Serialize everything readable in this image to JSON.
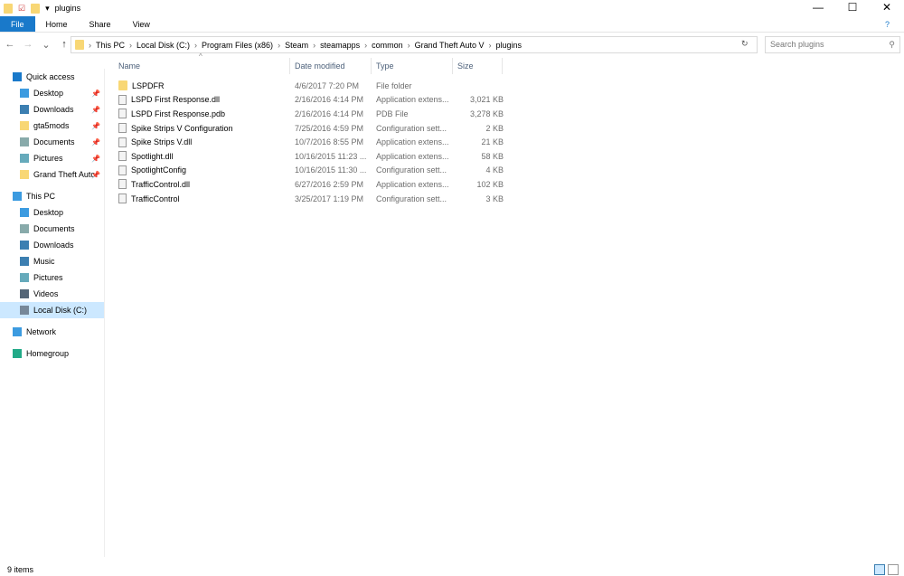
{
  "window": {
    "title": "plugins",
    "controls": [
      "—",
      "☐",
      "✕"
    ]
  },
  "ribbon": {
    "tabs": [
      "File",
      "Home",
      "Share",
      "View"
    ]
  },
  "address": {
    "crumbs": [
      "This PC",
      "Local Disk (C:)",
      "Program Files (x86)",
      "Steam",
      "steamapps",
      "common",
      "Grand Theft Auto V",
      "plugins"
    ],
    "search_placeholder": "Search plugins"
  },
  "sidebar": {
    "items": [
      {
        "label": "Quick access",
        "level": 0,
        "icon": "star-icon"
      },
      {
        "label": "Desktop",
        "level": 1,
        "icon": "desktop-icon",
        "pinned": true
      },
      {
        "label": "Downloads",
        "level": 1,
        "icon": "download-icon",
        "pinned": true
      },
      {
        "label": "gta5mods",
        "level": 1,
        "icon": "folder-icon",
        "pinned": true
      },
      {
        "label": "Documents",
        "level": 1,
        "icon": "documents-icon",
        "pinned": true
      },
      {
        "label": "Pictures",
        "level": 1,
        "icon": "pictures-icon",
        "pinned": true
      },
      {
        "label": "Grand Theft Auto V",
        "level": 1,
        "icon": "folder-icon",
        "pinned": true
      },
      {
        "label": "",
        "level": -1
      },
      {
        "label": "This PC",
        "level": 0,
        "icon": "computer-icon"
      },
      {
        "label": "Desktop",
        "level": 1,
        "icon": "desktop-icon"
      },
      {
        "label": "Documents",
        "level": 1,
        "icon": "documents-icon"
      },
      {
        "label": "Downloads",
        "level": 1,
        "icon": "download-icon"
      },
      {
        "label": "Music",
        "level": 1,
        "icon": "music-icon"
      },
      {
        "label": "Pictures",
        "level": 1,
        "icon": "pictures-icon"
      },
      {
        "label": "Videos",
        "level": 1,
        "icon": "videos-icon"
      },
      {
        "label": "Local Disk (C:)",
        "level": 1,
        "icon": "drive-icon",
        "selected": true
      },
      {
        "label": "",
        "level": -1
      },
      {
        "label": "Network",
        "level": 0,
        "icon": "network-icon"
      },
      {
        "label": "",
        "level": -1
      },
      {
        "label": "Homegroup",
        "level": 0,
        "icon": "homegroup-icon"
      }
    ]
  },
  "columns": [
    "Name",
    "Date modified",
    "Type",
    "Size"
  ],
  "files": [
    {
      "name": "LSPDFR",
      "date": "4/6/2017 7:20 PM",
      "type": "File folder",
      "size": "",
      "folder": true
    },
    {
      "name": "LSPD First Response.dll",
      "date": "2/16/2016 4:14 PM",
      "type": "Application extens...",
      "size": "3,021 KB"
    },
    {
      "name": "LSPD First Response.pdb",
      "date": "2/16/2016 4:14 PM",
      "type": "PDB File",
      "size": "3,278 KB"
    },
    {
      "name": "Spike Strips V Configuration",
      "date": "7/25/2016 4:59 PM",
      "type": "Configuration sett...",
      "size": "2 KB"
    },
    {
      "name": "Spike Strips V.dll",
      "date": "10/7/2016 8:55 PM",
      "type": "Application extens...",
      "size": "21 KB"
    },
    {
      "name": "Spotlight.dll",
      "date": "10/16/2015 11:23 ...",
      "type": "Application extens...",
      "size": "58 KB"
    },
    {
      "name": "SpotlightConfig",
      "date": "10/16/2015 11:30 ...",
      "type": "Configuration sett...",
      "size": "4 KB"
    },
    {
      "name": "TrafficControl.dll",
      "date": "6/27/2016 2:59 PM",
      "type": "Application extens...",
      "size": "102 KB"
    },
    {
      "name": "TrafficControl",
      "date": "3/25/2017 1:19 PM",
      "type": "Configuration sett...",
      "size": "3 KB"
    }
  ],
  "status": {
    "count": "9 items"
  }
}
